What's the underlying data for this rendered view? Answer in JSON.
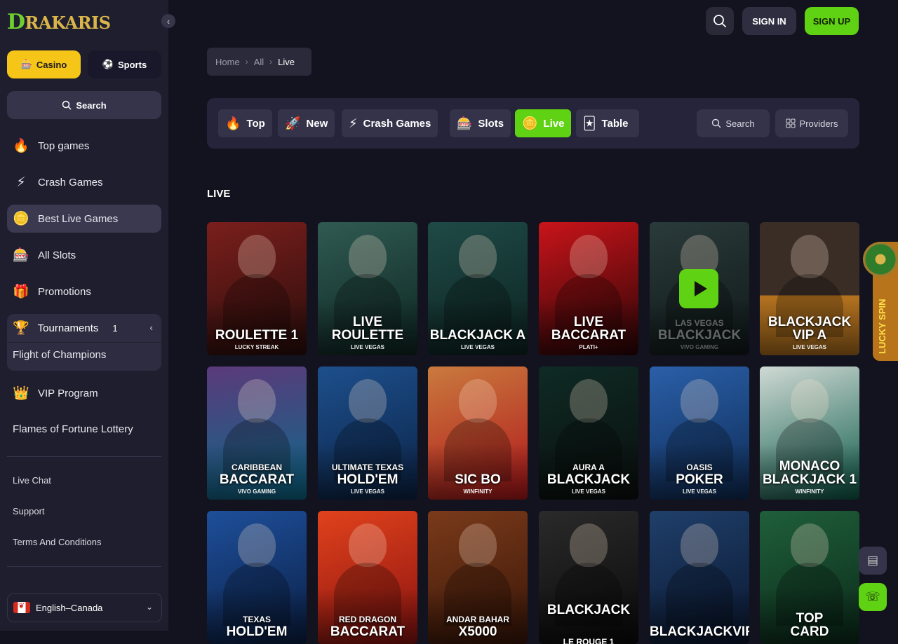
{
  "brand": {
    "logo_text": "RAKARIS",
    "logo_initial": "D"
  },
  "sidebar": {
    "collapse_icon": "chevron-left-icon",
    "casino_tab": "Casino",
    "sports_tab": "Sports",
    "search_label": "Search",
    "items": [
      {
        "label": "Top games",
        "icon": "fire-icon"
      },
      {
        "label": "Crash Games",
        "icon": "lightning-icon"
      },
      {
        "label": "Best Live Games",
        "icon": "chips-icon",
        "active": true
      },
      {
        "label": "All Slots",
        "icon": "slot-machine-icon"
      },
      {
        "label": "Promotions",
        "icon": "gift-icon"
      }
    ],
    "tournaments": {
      "label": "Tournaments",
      "count": "1",
      "sub_item": "Flight of Champions"
    },
    "vip": {
      "label": "VIP Program",
      "icon": "crown-icon"
    },
    "lottery": "Flames of Fortune Lottery",
    "footer_links": [
      "Live Chat",
      "Support",
      "Terms And Conditions"
    ],
    "language": "English–Canada"
  },
  "header": {
    "signin": "SIGN IN",
    "signup": "SIGN UP"
  },
  "breadcrumb": {
    "home": "Home",
    "all": "All",
    "current": "Live"
  },
  "categories": [
    {
      "label": "Top",
      "icon": "fire-icon"
    },
    {
      "label": "New",
      "icon": "rocket-icon"
    },
    {
      "label": "Crash Games",
      "icon": "lightning-icon"
    },
    {
      "label": "Slots",
      "icon": "slot-machine-icon"
    },
    {
      "label": "Live",
      "icon": "chips-icon",
      "active": true
    },
    {
      "label": "Table",
      "icon": "cards-icon"
    }
  ],
  "filters": {
    "search": "Search",
    "providers": "Providers"
  },
  "section_title": "LIVE",
  "games": [
    {
      "line1": "",
      "line2": "ROULETTE 1",
      "line3": "LUCKY STREAK"
    },
    {
      "line1": "",
      "line2": "LIVE\nROULETTE",
      "line3": "LIVE VEGAS"
    },
    {
      "line1": "",
      "line2": "BLACKJACK A",
      "line3": "LIVE VEGAS"
    },
    {
      "line1": "",
      "line2": "LIVE\nBACCARAT",
      "line3": "PLATI+"
    },
    {
      "line1": "LAS VEGAS",
      "line2": "BLACKJACK",
      "line3": "VIVO GAMING"
    },
    {
      "line1": "",
      "line2": "BLACKJACK\nVIP A",
      "line3": "LIVE VEGAS"
    },
    {
      "line1": "CARIBBEAN",
      "line2": "BACCARAT",
      "line3": "VIVO GAMING"
    },
    {
      "line1": "ULTIMATE TEXAS",
      "line2": "HOLD'EM",
      "line3": "LIVE VEGAS"
    },
    {
      "line1": "",
      "line2": "SIC BO",
      "line3": "WINFINITY"
    },
    {
      "line1": "AURA A",
      "line2": "BLACKJACK",
      "line3": "LIVE VEGAS"
    },
    {
      "line1": "OASIS",
      "line2": "POKER",
      "line3": "LIVE VEGAS"
    },
    {
      "line1": "",
      "line2": "MONACO\nBLACKJACK 1",
      "line3": "WINFINITY"
    },
    {
      "line1": "TEXAS",
      "line2": "HOLD'EM",
      "line3": ""
    },
    {
      "line1": "RED DRAGON",
      "line2": "BACCARAT",
      "line3": ""
    },
    {
      "line1": "ANDAR BAHAR",
      "line2": "X5000",
      "line3": ""
    },
    {
      "line1": "",
      "line2": "BLACKJACK",
      "line3": "LE ROUGE 1"
    },
    {
      "line1": "",
      "line2": "BLACKJACKVIP",
      "line3": ""
    },
    {
      "line1": "",
      "line2": "TOP\nCARD",
      "line3": ""
    }
  ],
  "lucky_spin": "LUCKY SPIN",
  "colors": {
    "accent_green": "#5fd313",
    "casino_yellow": "#f5c518",
    "background": "#13121f",
    "sidebar": "#1f1e2e"
  }
}
